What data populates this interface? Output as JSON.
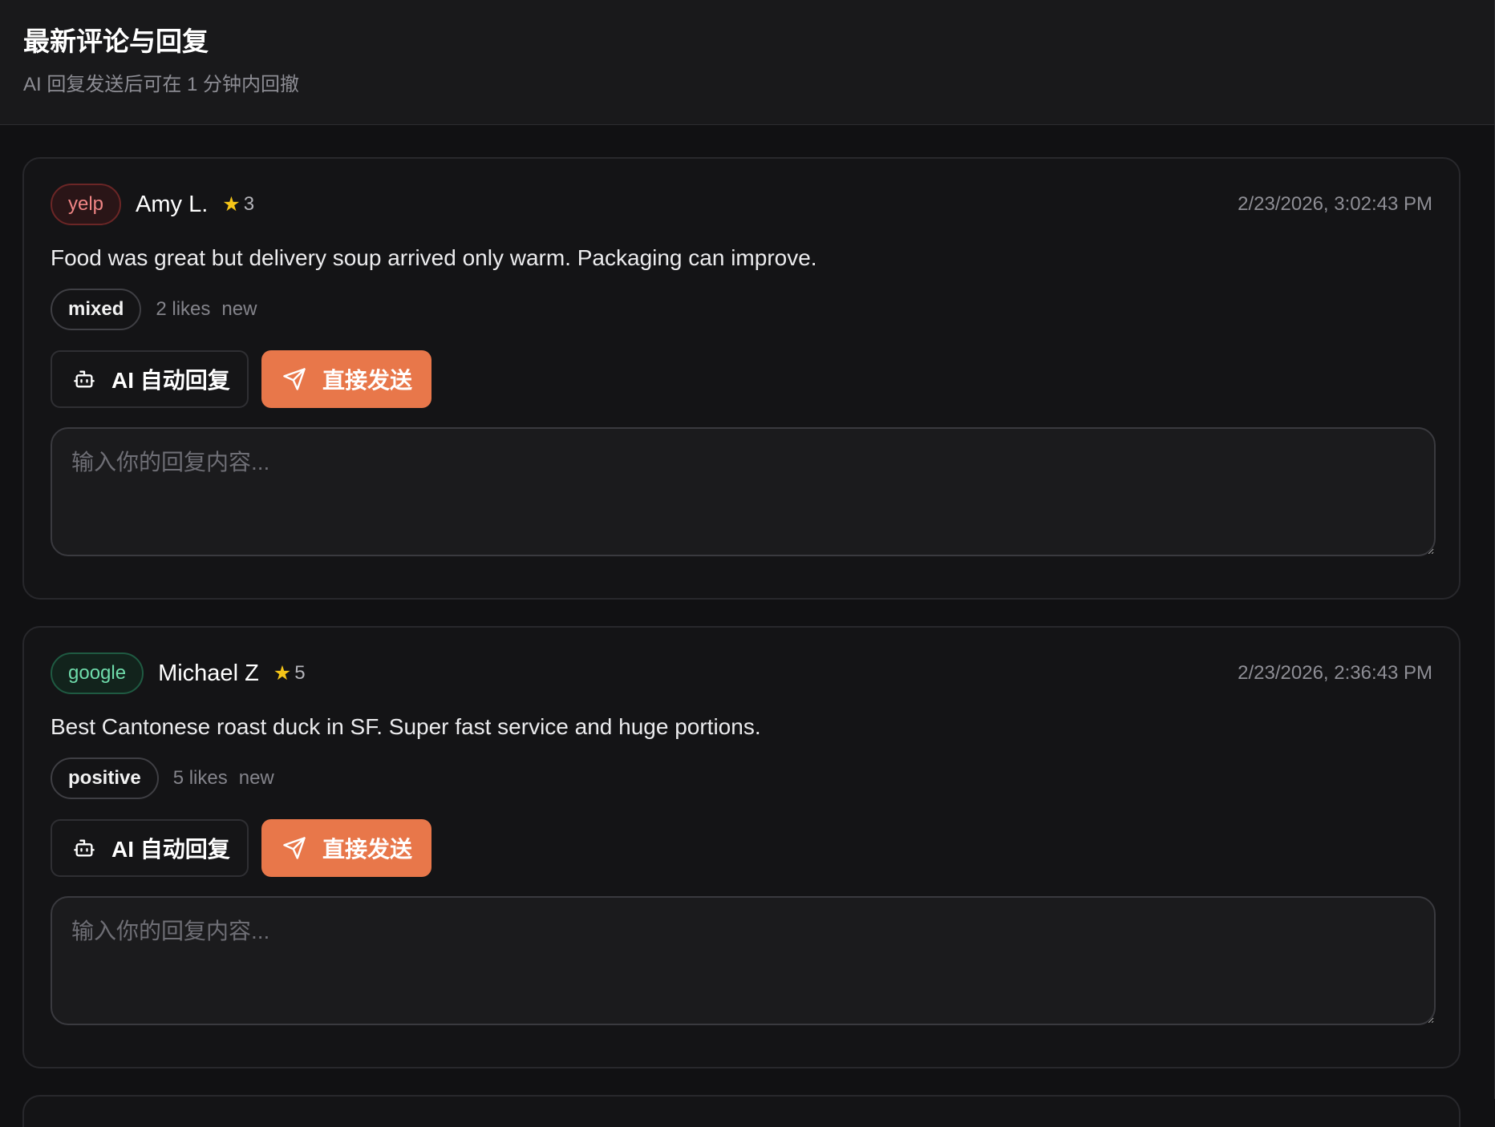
{
  "header": {
    "title": "最新评论与回复",
    "subtitle": "AI 回复发送后可在 1 分钟内回撤"
  },
  "colors": {
    "accent": "#e8774a",
    "yelp_text": "#f08585",
    "yelp_border": "#6b2626",
    "yelp_bg": "#2a1517",
    "google_text": "#6fdcab",
    "google_border": "#1f5a42",
    "google_bg": "#12231c",
    "star": "#f5c518"
  },
  "reviews": [
    {
      "platform": "yelp",
      "author": "Amy L.",
      "star_icon": "★",
      "rating": "3",
      "date": "2/23/2026, 3:02:43 PM",
      "text": "Food was great but delivery soup arrived only warm. Packaging can improve.",
      "sentiment": "mixed",
      "likes": "2 likes",
      "status": "new",
      "ai_button": "AI 自动回复",
      "send_button": "直接发送",
      "reply_placeholder": "输入你的回复内容..."
    },
    {
      "platform": "google",
      "author": "Michael Z",
      "star_icon": "★",
      "rating": "5",
      "date": "2/23/2026, 2:36:43 PM",
      "text": "Best Cantonese roast duck in SF. Super fast service and huge portions.",
      "sentiment": "positive",
      "likes": "5 likes",
      "status": "new",
      "ai_button": "AI 自动回复",
      "send_button": "直接发送",
      "reply_placeholder": "输入你的回复内容..."
    }
  ]
}
